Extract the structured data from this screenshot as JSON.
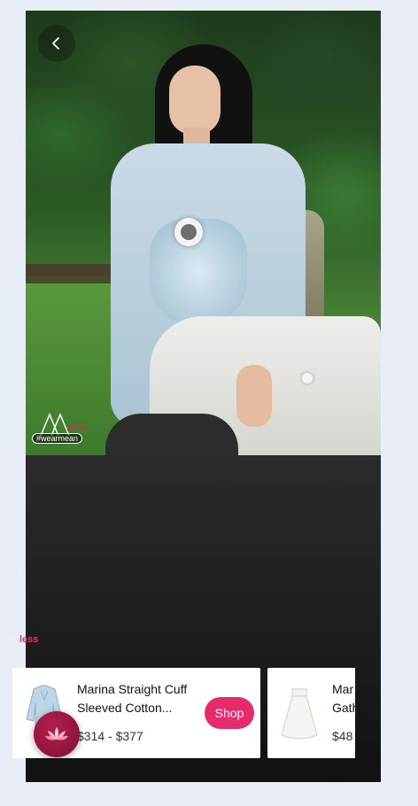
{
  "brand": {
    "logo_text": "M",
    "hashtag": "#wearmean"
  },
  "actions": {
    "less_label": "less"
  },
  "products": [
    {
      "title": "Marina Straight Cuff Sleeved Cotton...",
      "price": "$314 - $377",
      "cta": "Shop"
    },
    {
      "title": "Mar Gath",
      "title_line1": "Mar",
      "title_line2": "Gath",
      "price": "$48"
    }
  ],
  "colors": {
    "accent": "#e62b6d",
    "less_link": "#e4306f",
    "lotus_button": "#9a1940"
  },
  "icons": {
    "back": "chevron-left-icon",
    "floating": "lotus-icon"
  }
}
